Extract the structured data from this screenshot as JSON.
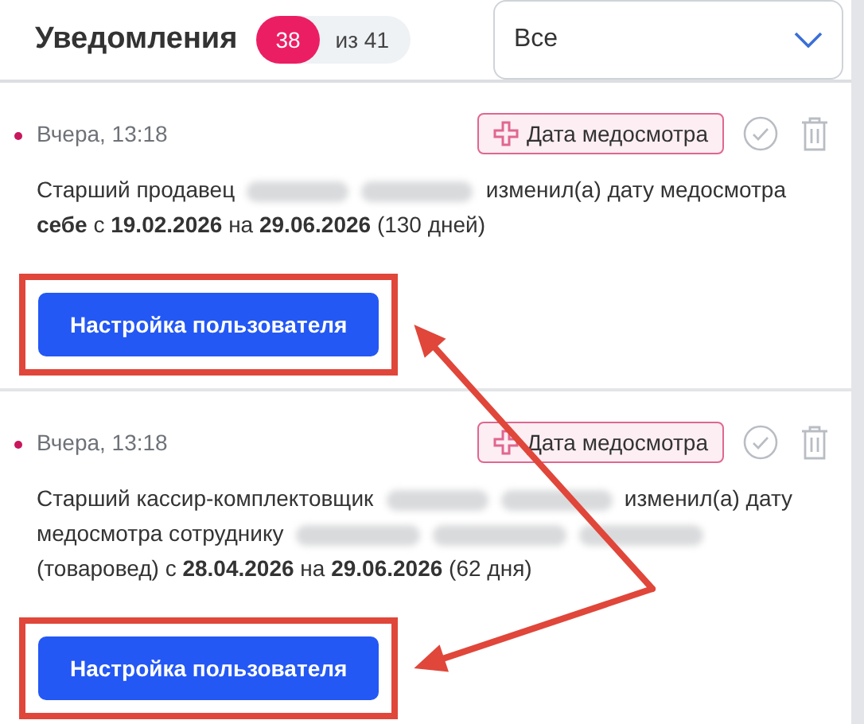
{
  "header": {
    "title": "Уведомления",
    "unread_count": "38",
    "total": "из 41"
  },
  "filter": {
    "value": "Все"
  },
  "notifications": [
    {
      "unread": true,
      "time": "Вчера, 13:18",
      "tag": "Дата медосмотра",
      "message": [
        {
          "kind": "text",
          "text": "Старший продавец"
        },
        {
          "kind": "redacted"
        },
        {
          "kind": "text",
          "text": "изменил(а) дату медосмотра"
        },
        {
          "kind": "text",
          "text": "**себе** с **19.02.2026** на **29.06.2026** (130 дней)"
        }
      ],
      "action": {
        "label": "Настройка пользователя",
        "highlighted": true
      }
    },
    {
      "unread": true,
      "time": "Вчера, 13:18",
      "tag": "Дата медосмотра",
      "message": [
        {
          "kind": "text",
          "text": "Старший кассир-комплектовщик"
        },
        {
          "kind": "redacted"
        },
        {
          "kind": "text",
          "text": "изменил(а) дату"
        },
        {
          "kind": "text",
          "text": "медосмотра сотруднику"
        },
        {
          "kind": "redacted_long"
        },
        {
          "kind": "text",
          "text": "(товаровед) с **28.04.2026** на **29.06.2026** (62 дня)"
        }
      ],
      "action": {
        "label": "Настройка пользователя",
        "highlighted": true
      }
    }
  ]
}
